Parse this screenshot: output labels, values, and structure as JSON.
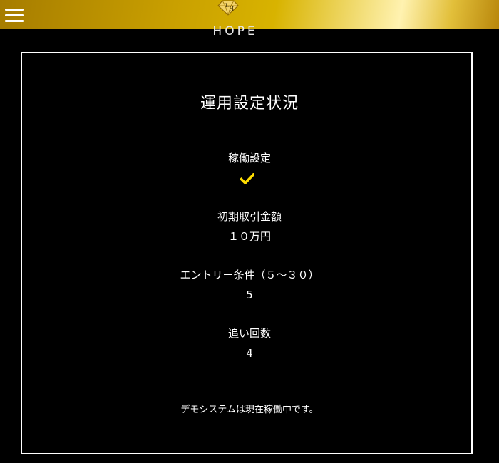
{
  "header": {
    "brand": "HOPE",
    "emblem_letters": "LH",
    "gradient_colors": [
      "#a67c00",
      "#d8b300",
      "#fff2b0",
      "#b8860b"
    ]
  },
  "panel": {
    "title": "運用設定状況",
    "settings": [
      {
        "label": "稼働設定",
        "value_type": "check",
        "checked": true
      },
      {
        "label": "初期取引金額",
        "value": "１０万円"
      },
      {
        "label": "エントリー条件（５～３０）",
        "value": "5"
      },
      {
        "label": "追い回数",
        "value": "4"
      }
    ],
    "status_message": "デモシステムは現在稼働中です。",
    "accent_color": "#ffdd00"
  }
}
